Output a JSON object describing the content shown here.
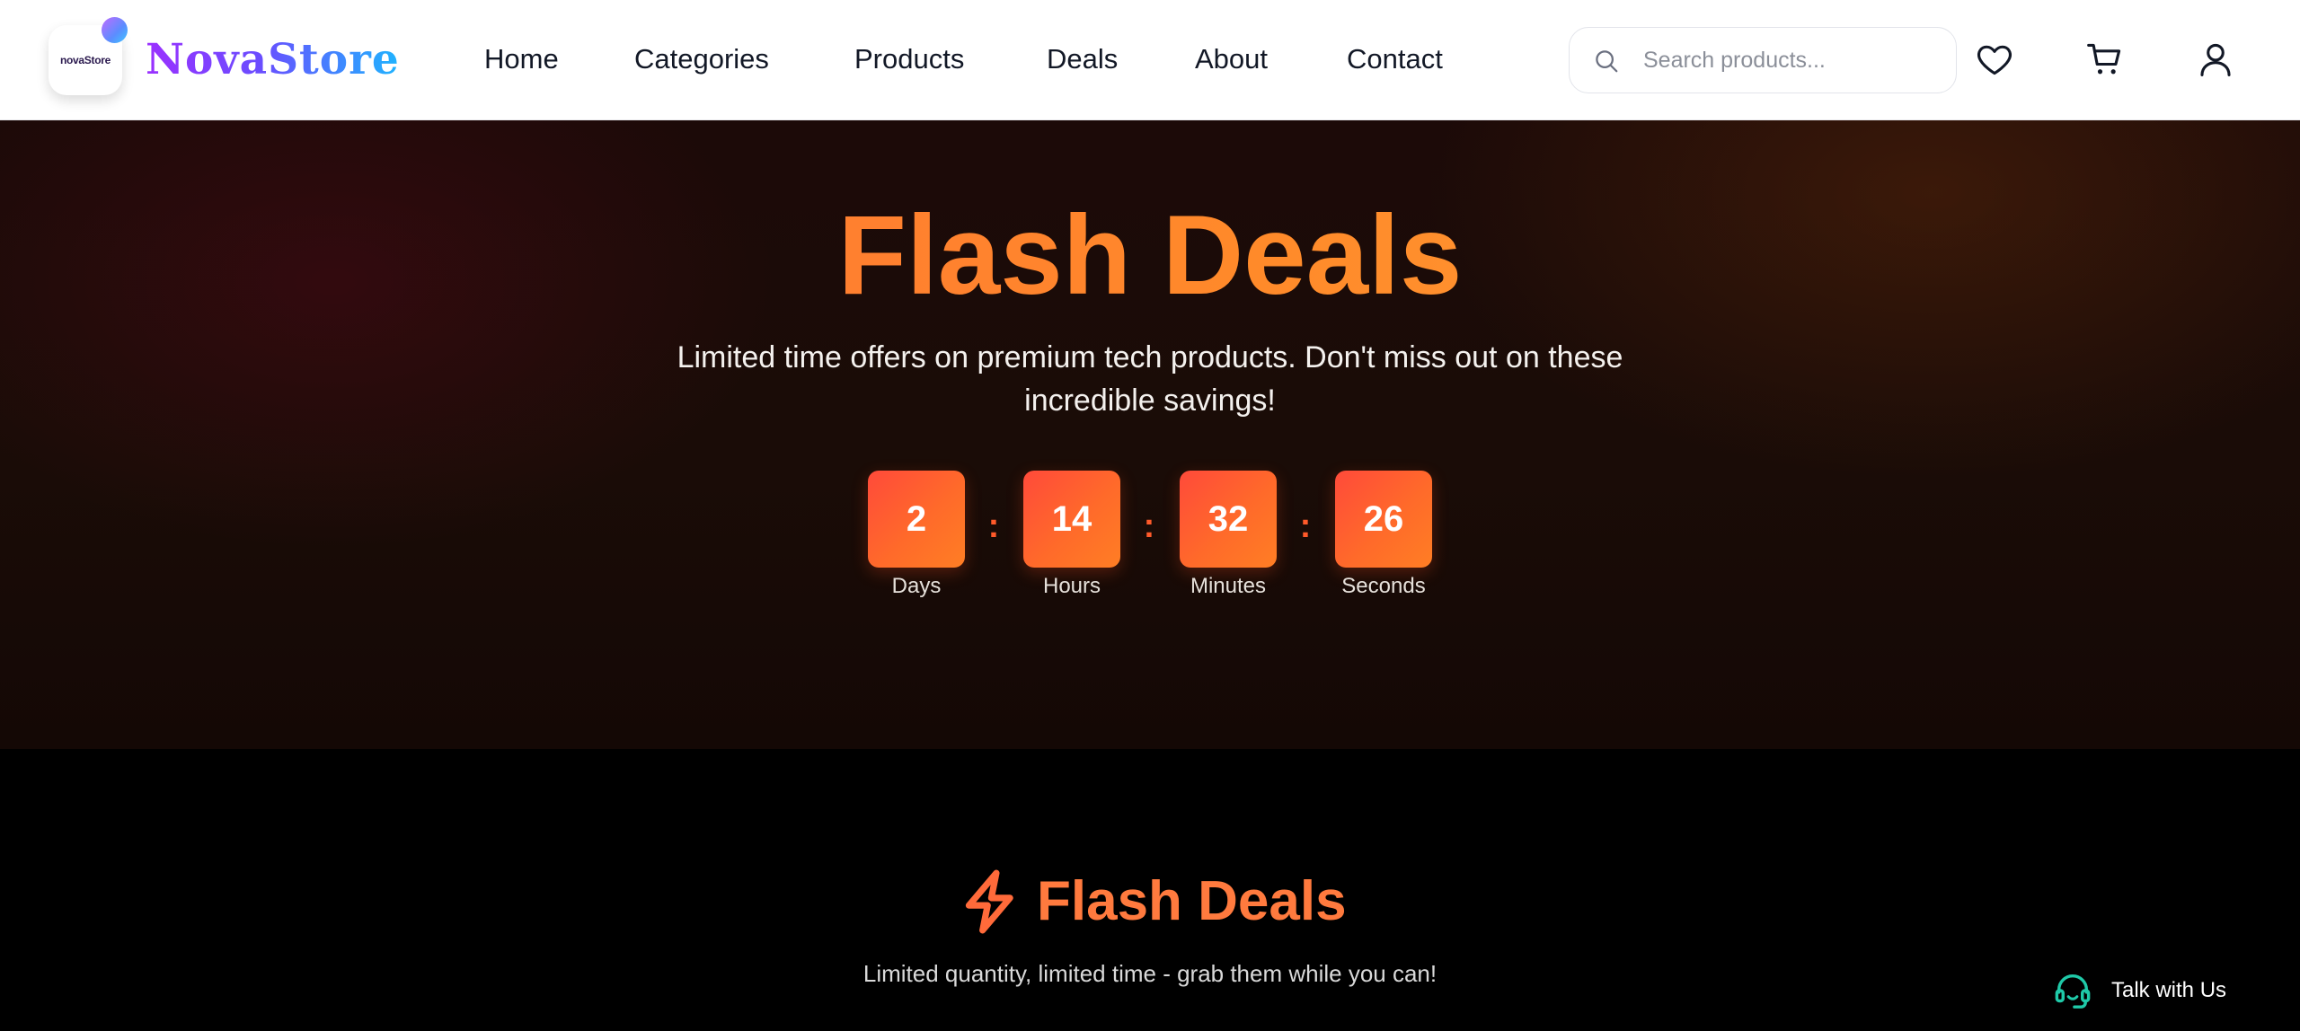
{
  "brand": {
    "name": "NovaStore",
    "logo_text": "novaStore"
  },
  "nav": {
    "links": [
      "Home",
      "Categories",
      "Products",
      "Deals",
      "About",
      "Contact"
    ]
  },
  "search": {
    "placeholder": "Search products..."
  },
  "header_icons": [
    "heart-icon",
    "cart-icon",
    "user-icon"
  ],
  "hero": {
    "title": "Flash Deals",
    "subtitle": "Limited time offers on premium tech products. Don't miss out on these incredible savings!",
    "countdown": [
      {
        "value": "2",
        "label": "Days"
      },
      {
        "value": "14",
        "label": "Hours"
      },
      {
        "value": "32",
        "label": "Minutes"
      },
      {
        "value": "26",
        "label": "Seconds"
      }
    ],
    "separator": ":"
  },
  "section": {
    "title": "Flash Deals",
    "subtitle": "Limited quantity, limited time - grab them while you can!"
  },
  "chat": {
    "label": "Talk with Us"
  },
  "colors": {
    "accent": "#ff6a2a",
    "accent_red": "#ff4a3a",
    "brand_purple": "#9b30ff",
    "brand_blue": "#1fb4ff",
    "support_teal": "#1fc9a8"
  }
}
